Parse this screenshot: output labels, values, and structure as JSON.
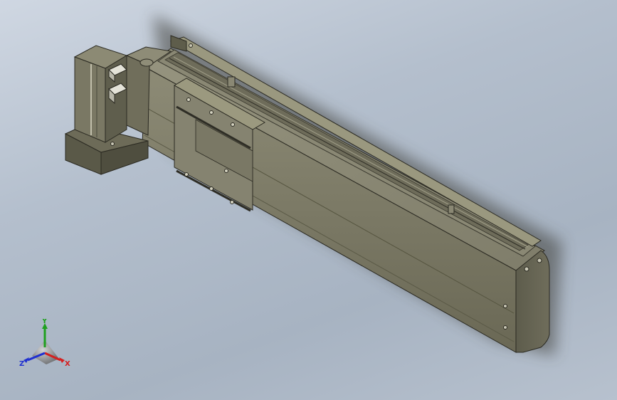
{
  "viewport": {
    "background_top": "#cfd7e2",
    "background_bottom": "#a7b3c2",
    "model_color": "#7c7a66",
    "model_shadow_color": "#4e4d40"
  },
  "triad": {
    "x_label": "X",
    "y_label": "Y",
    "z_label": "Z",
    "x_color": "#d42020",
    "y_color": "#1fa01f",
    "z_color": "#2030d0"
  }
}
